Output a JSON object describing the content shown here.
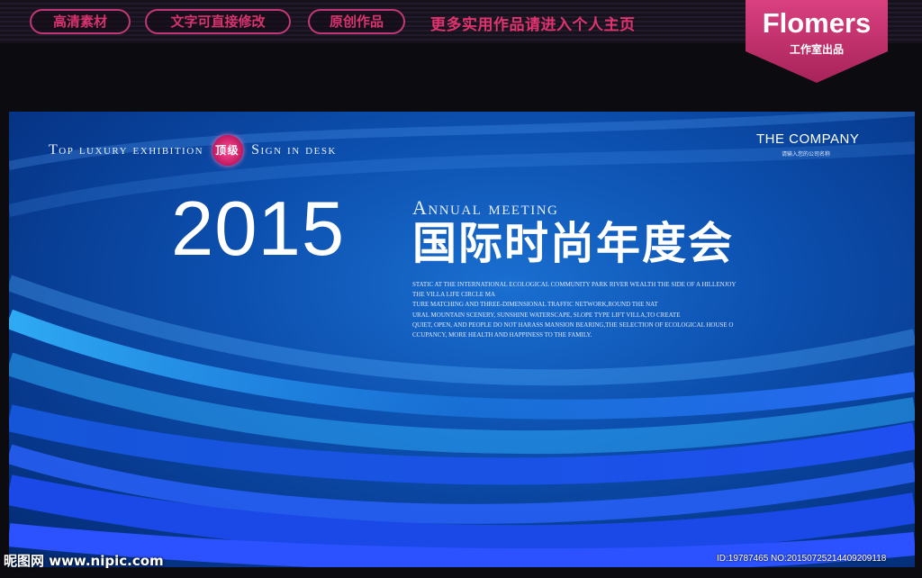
{
  "header": {
    "buttons": [
      "高清素材",
      "文字可直接修改",
      "原创作品"
    ],
    "promo": "更多实用作品请进入个人主页",
    "brand": {
      "name": "Flomers",
      "sub": "工作室出品"
    }
  },
  "banner": {
    "tagline_a": "Top luxury exhibition",
    "badge": "顶级",
    "tagline_b": "Sign in desk",
    "company": "THE COMPANY",
    "company_sub": "请输入您的公司名称",
    "year": "2015",
    "annual": "Annual meeting",
    "zh_title": "国际时尚年度会",
    "desc_lines": [
      "STATIC AT THE INTERNATIONAL ECOLOGICAL COMMUNITY PARK RIVER WEALTH THE SIDE OF A HILLENJOY",
      "THE VILLA LIFE CIRCLE MA",
      "TURE MATCHING AND THREE-DIMENSIONAL TRAFFIC NETWORK,ROUND THE NAT",
      "URAL MOUNTAIN SCENERY, SUNSHINE WATERSCAPE, SLOPE TYPE LIFT VILLA,TO CREATE",
      "QUIET, OPEN, AND PEOPLE DO NOT HARASS MANSION BEARING,THE SELECTION OF ECOLOGICAL HOUSE O",
      "CCUPANCY, MORE HEALTH AND HAPPINESS TO THE FAMILY."
    ]
  },
  "watermark": "昵图网 www.nipic.com",
  "site_id": "ID:19787465 NO:20150725214409209118",
  "colors": {
    "accent": "#d8336f",
    "banner": "#0c4fae",
    "brand": "#c22b66"
  }
}
